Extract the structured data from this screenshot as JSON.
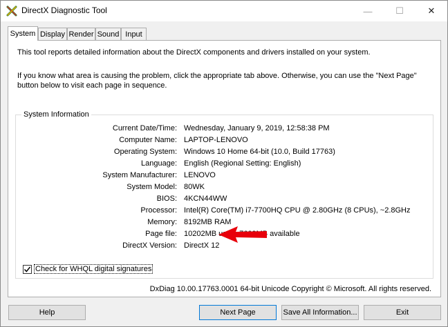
{
  "window": {
    "title": "DirectX Diagnostic Tool",
    "minimize_glyph": "—",
    "maximize_glyph": "☐",
    "close_glyph": "✕"
  },
  "tabs": [
    {
      "label": "System",
      "active": true
    },
    {
      "label": "Display",
      "active": false
    },
    {
      "label": "Render",
      "active": false
    },
    {
      "label": "Sound",
      "active": false
    },
    {
      "label": "Input",
      "active": false
    }
  ],
  "intro": {
    "line1": "This tool reports detailed information about the DirectX components and drivers installed on your system.",
    "line2": "If you know what area is causing the problem, click the appropriate tab above.  Otherwise, you can use the \"Next Page\" button below to visit each page in sequence."
  },
  "system_info": {
    "title": "System Information",
    "rows": [
      {
        "label": "Current Date/Time:",
        "value": "Wednesday, January 9, 2019, 12:58:38 PM"
      },
      {
        "label": "Computer Name:",
        "value": "LAPTOP-LENOVO"
      },
      {
        "label": "Operating System:",
        "value": "Windows 10 Home 64-bit (10.0, Build 17763)"
      },
      {
        "label": "Language:",
        "value": "English (Regional Setting: English)"
      },
      {
        "label": "System Manufacturer:",
        "value": "LENOVO"
      },
      {
        "label": "System Model:",
        "value": "80WK"
      },
      {
        "label": "BIOS:",
        "value": "4KCN44WW"
      },
      {
        "label": "Processor:",
        "value": "Intel(R) Core(TM) i7-7700HQ CPU @ 2.80GHz (8 CPUs), ~2.8GHz"
      },
      {
        "label": "Memory:",
        "value": "8192MB RAM"
      },
      {
        "label": "Page file:",
        "value": "10202MB used, 7609MB available"
      },
      {
        "label": "DirectX Version:",
        "value": "DirectX 12"
      }
    ]
  },
  "whql_checkbox": {
    "label": "Check for WHQL digital signatures",
    "checked": true
  },
  "footer": {
    "version_text": "DxDiag 10.00.17763.0001 64-bit Unicode  Copyright © Microsoft. All rights reserved."
  },
  "buttons": {
    "help": "Help",
    "next_page": "Next Page",
    "save_all": "Save All Information...",
    "exit": "Exit"
  },
  "colors": {
    "annotation_arrow": "#e8000b",
    "accent": "#0078d7"
  }
}
